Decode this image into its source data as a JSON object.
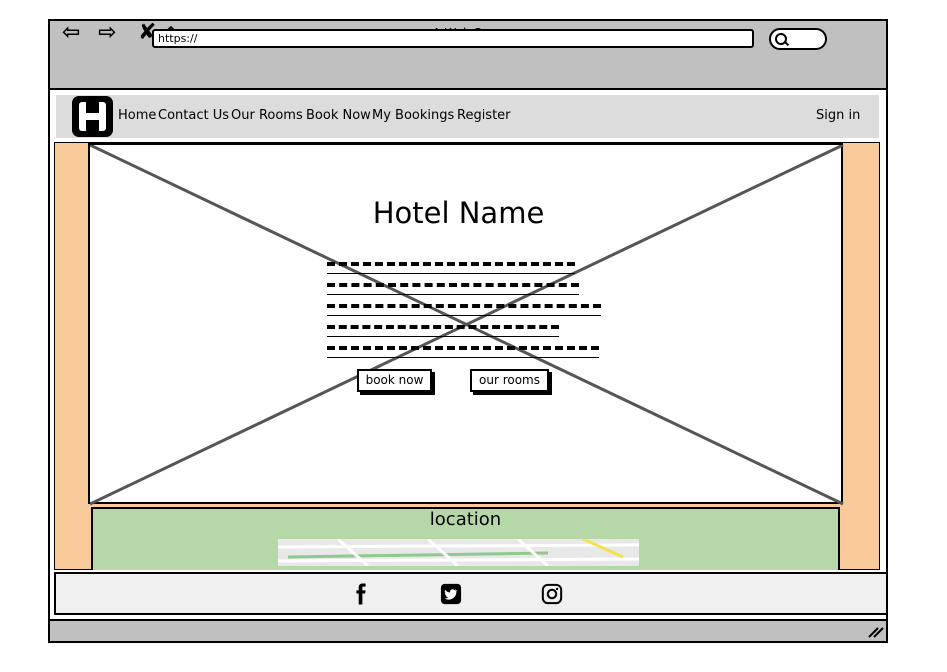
{
  "browser": {
    "window_title": "A Web Page",
    "url": "https://",
    "nav_icons": [
      "back-arrow-icon",
      "forward-arrow-icon",
      "close-x-icon",
      "home-icon"
    ]
  },
  "navbar": {
    "logo_letter": "H",
    "items": [
      {
        "label": "Home"
      },
      {
        "label": "Contact Us"
      },
      {
        "label": "Our Rooms"
      },
      {
        "label": "Book Now"
      },
      {
        "label": "My Bookings"
      },
      {
        "label": "Register"
      }
    ],
    "sign_in": "Sign in"
  },
  "hero": {
    "title": "Hotel Name",
    "buttons": {
      "book_now": "book now",
      "our_rooms": "our rooms"
    }
  },
  "location": {
    "title": "location"
  },
  "footer": {
    "social_icons": [
      "facebook-icon",
      "twitter-icon",
      "instagram-icon"
    ]
  },
  "colors": {
    "chrome": "#c0c0c0",
    "navbar": "#dcdcdc",
    "page_background": "#f8ca9a",
    "location_background": "#b6d7a8",
    "footer": "#f0f0f0"
  }
}
